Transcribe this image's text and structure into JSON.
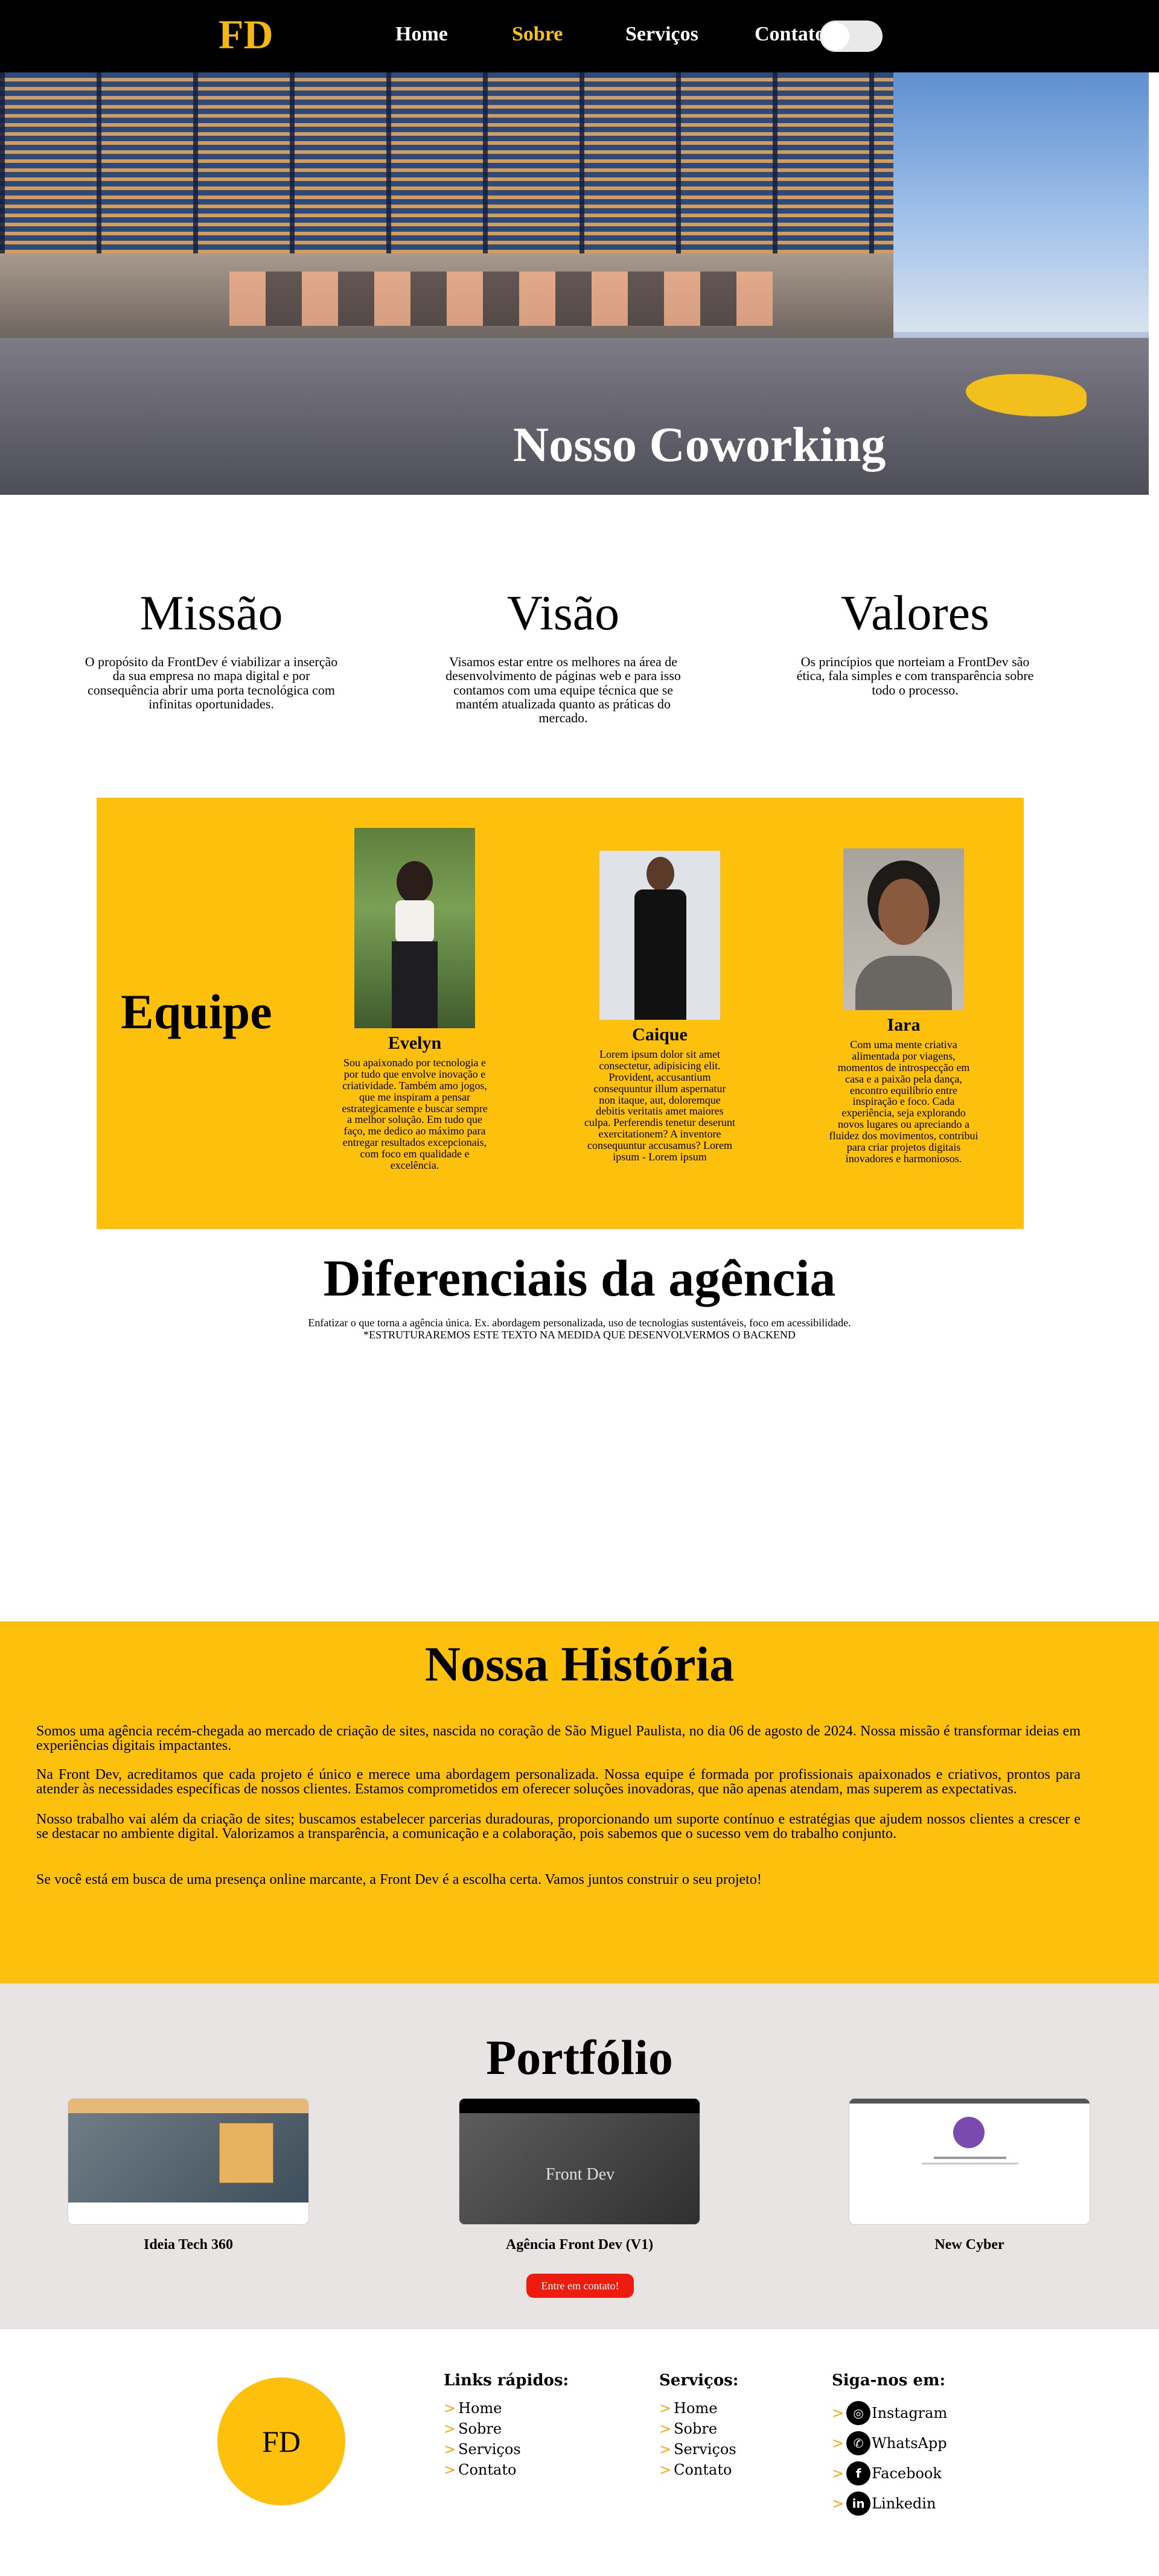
{
  "nav": {
    "logo": "FD",
    "links": [
      "Home",
      "Sobre",
      "Serviços",
      "Contato"
    ],
    "active": "Sobre",
    "theme_toggle": "off"
  },
  "hero": {
    "title": "Nosso Coworking"
  },
  "mvv": [
    {
      "title": "Missão",
      "text": "O propósito da FrontDev é viabilizar a inserção da sua empresa no mapa digital e por consequência abrir uma porta tecnológica com infinitas oportunidades."
    },
    {
      "title": "Visão",
      "text": "Visamos estar entre os melhores na área de desenvolvimento de páginas web e para isso contamos com uma equipe técnica que se mantém atualizada quanto as práticas do mercado."
    },
    {
      "title": "Valores",
      "text": "Os princípios que norteiam a FrontDev são ética, fala simples e com transparência sobre todo o processo."
    }
  ],
  "team": {
    "title": "Equipe",
    "members": [
      {
        "name": "Evelyn",
        "bio": "Sou apaixonado por tecnologia e por tudo que envolve inovação e criatividade. Também amo jogos, que me inspiram a pensar estrategicamente e buscar sempre a melhor solução. Em tudo que faço, me dedico ao máximo para entregar resultados excepcionais, com foco em qualidade e excelência."
      },
      {
        "name": "Caique",
        "bio": "Lorem ipsum dolor sit amet consectetur, adipisicing elit. Provident, accusantium consequuntur illum aspernatur non itaque, aut, doloremque debitis veritatis amet maiores culpa. Perferendis tenetur deserunt exercitationem? A inventore consequuntur accusamus? Lorem ipsum - Lorem ipsum"
      },
      {
        "name": "Iara",
        "bio": "Com uma mente criativa alimentada por viagens, momentos de introspecção em casa e a paixão pela dança, encontro equilíbrio entre inspiração e foco. Cada experiência, seja explorando novos lugares ou apreciando a fluidez dos movimentos, contribui para criar projetos digitais inovadores e harmoniosos."
      }
    ]
  },
  "diferenciais": {
    "title": "Diferenciais da agência",
    "line1": "Enfatizar o que torna a agência única. Ex. abordagem personalizada, uso de tecnologias sustentáveis, foco em acessibilidade.",
    "line2": "*ESTRUTURAREMOS ESTE TEXTO NA MEDIDA QUE DESENVOLVERMOS O BACKEND"
  },
  "historia": {
    "title": "Nossa História",
    "paragraphs": [
      "Somos uma agência recém-chegada ao mercado de criação de sites, nascida no coração de São Miguel Paulista, no dia 06 de agosto de 2024. Nossa missão é transformar ideias em experiências digitais impactantes.",
      "Na Front Dev, acreditamos que cada projeto é único e merece uma abordagem personalizada. Nossa equipe é formada por profissionais apaixonados e criativos, prontos para atender às necessidades específicas de nossos clientes. Estamos comprometidos em oferecer soluções inovadoras, que não apenas atendam, mas superem as expectativas.",
      "Nosso trabalho vai além da criação de sites; buscamos estabelecer parcerias duradouras, proporcionando um suporte contínuo e estratégias que ajudem nossos clientes a crescer e se destacar no ambiente digital. Valorizamos a transparência, a comunicação e a colaboração, pois sabemos que o sucesso vem do trabalho conjunto.",
      "Se você está em busca de uma presença online marcante, a Front Dev é a escolha certa. Vamos juntos construir o seu projeto!"
    ]
  },
  "portfolio": {
    "title": "Portfólio",
    "items": [
      {
        "caption": "Ideia Tech 360",
        "thumb_text": ""
      },
      {
        "caption": "Agência Front Dev (V1)",
        "thumb_text": "Front Dev"
      },
      {
        "caption": "New Cyber",
        "thumb_text": ""
      }
    ],
    "button": "Entre em contato!"
  },
  "footer": {
    "logo": "FD",
    "quick_links": {
      "title": "Links rápidos:",
      "items": [
        "Home",
        "Sobre",
        "Serviços",
        "Contato"
      ]
    },
    "services": {
      "title": "Serviços:",
      "items": [
        "Home",
        "Sobre",
        "Serviços",
        "Contato"
      ]
    },
    "social": {
      "title": "Siga-nos em:",
      "items": [
        {
          "label": "Instagram",
          "icon": "instagram-icon"
        },
        {
          "label": "WhatsApp",
          "icon": "whatsapp-icon"
        },
        {
          "label": "Facebook",
          "icon": "facebook-icon"
        },
        {
          "label": "Linkedin",
          "icon": "linkedin-icon"
        }
      ]
    },
    "arrow": ">"
  },
  "colors": {
    "accent": "#fdc00c",
    "nav_bg": "#000000",
    "button": "#ee1c0e",
    "portfolio_bg": "#e8e4e3"
  }
}
